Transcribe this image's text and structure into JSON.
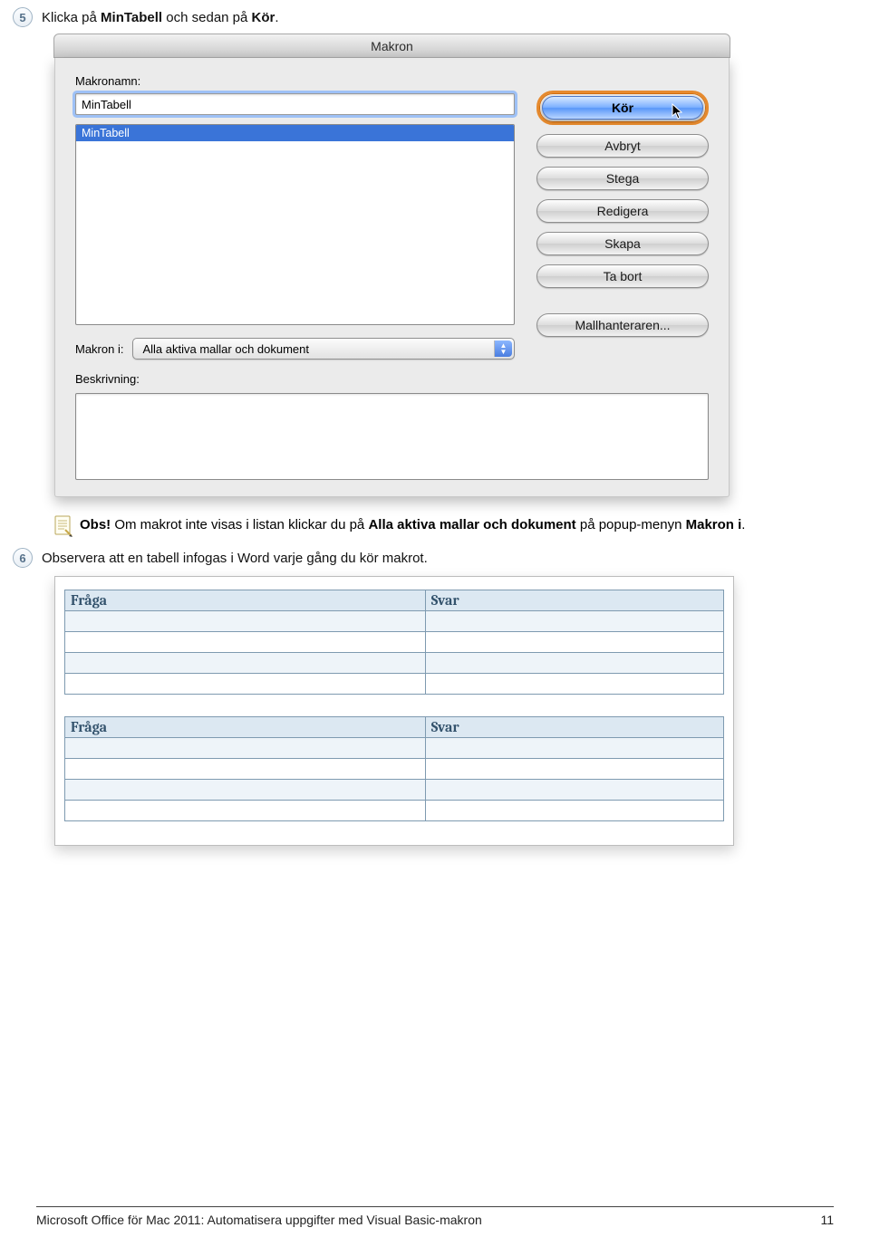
{
  "steps": {
    "five": {
      "badge": "5",
      "prefix": "Klicka på ",
      "bold1": "MinTabell",
      "mid": " och sedan på ",
      "bold2": "Kör",
      "suffix": "."
    },
    "six": {
      "badge": "6",
      "text": "Observera att en tabell infogas i Word varje gång du kör makrot."
    }
  },
  "dialog": {
    "title": "Makron",
    "name_label": "Makronamn:",
    "name_value": "MinTabell",
    "list_item": "MinTabell",
    "in_label": "Makron i:",
    "in_value": "Alla aktiva mallar och dokument",
    "desc_label": "Beskrivning:",
    "buttons": {
      "run": "Kör",
      "cancel": "Avbryt",
      "step": "Stega",
      "edit": "Redigera",
      "create": "Skapa",
      "delete": "Ta bort",
      "organizer": "Mallhanteraren..."
    }
  },
  "note": {
    "lead": "Obs!",
    "t1": "Om makrot inte visas i listan klickar du på ",
    "b1": "Alla aktiva mallar och dokument",
    "t2": " på popup-menyn ",
    "b2": "Makron i",
    "t3": "."
  },
  "word_tables": {
    "col1": "Fråga",
    "col2": "Svar"
  },
  "footer": {
    "left": "Microsoft Office för Mac 2011: Automatisera uppgifter med Visual Basic-makron",
    "right": "11"
  }
}
